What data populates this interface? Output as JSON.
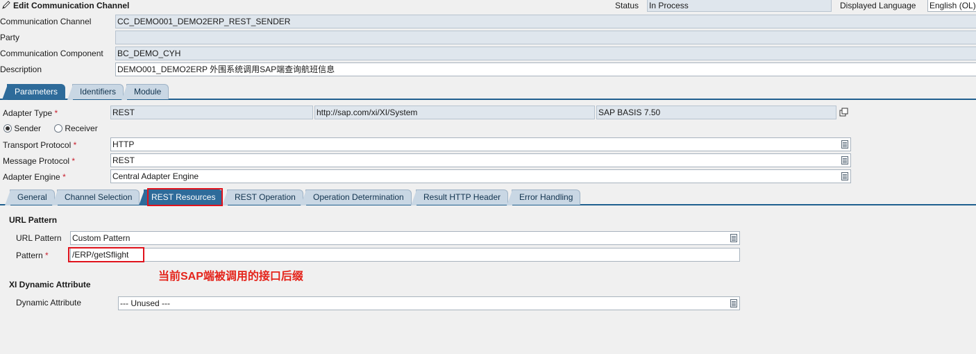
{
  "window": {
    "title": "Edit Communication Channel"
  },
  "header": {
    "status_label": "Status",
    "status_value": "In Process",
    "language_label": "Displayed Language",
    "language_value": "English (OL)"
  },
  "object": {
    "channel_label": "Communication Channel",
    "channel_value": "CC_DEMO001_DEMO2ERP_REST_SENDER",
    "party_label": "Party",
    "party_value": "",
    "component_label": "Communication Component",
    "component_value": "BC_DEMO_CYH",
    "description_label": "Description",
    "description_value": "DEMO001_DEMO2ERP 外围系统调用SAP端查询航班信息"
  },
  "main_tabs": [
    {
      "label": "Parameters",
      "active": true
    },
    {
      "label": "Identifiers",
      "active": false
    },
    {
      "label": "Module",
      "active": false
    }
  ],
  "parameters": {
    "adapter_type_label": "Adapter Type",
    "adapter_type_value": "REST",
    "adapter_namespace": "http://sap.com/xi/XI/System",
    "adapter_swcv": "SAP BASIS 7.50",
    "sender_label": "Sender",
    "receiver_label": "Receiver",
    "direction": "Sender",
    "transport_label": "Transport Protocol",
    "transport_value": "HTTP",
    "message_label": "Message Protocol",
    "message_value": "REST",
    "engine_label": "Adapter Engine",
    "engine_value": "Central Adapter Engine"
  },
  "sub_tabs": [
    {
      "label": "General",
      "active": false
    },
    {
      "label": "Channel Selection",
      "active": false
    },
    {
      "label": "REST Resources",
      "active": true
    },
    {
      "label": "REST Operation",
      "active": false
    },
    {
      "label": "Operation Determination",
      "active": false
    },
    {
      "label": "Result HTTP Header",
      "active": false
    },
    {
      "label": "Error Handling",
      "active": false
    }
  ],
  "rest_resources": {
    "url_pattern_heading": "URL Pattern",
    "url_pattern_label": "URL Pattern",
    "url_pattern_value": "Custom Pattern",
    "pattern_label": "Pattern",
    "pattern_value": "/ERP/getSflight",
    "dynamic_heading": "XI Dynamic Attribute",
    "dynamic_label": "Dynamic Attribute",
    "dynamic_value": "--- Unused ---"
  },
  "annotation": {
    "text": "当前SAP端被调用的接口后缀"
  },
  "required_mark": "*",
  "colors": {
    "active_tab": "#2e6b9a",
    "highlight_box": "#e0121c",
    "annotation_text": "#e4241b"
  }
}
